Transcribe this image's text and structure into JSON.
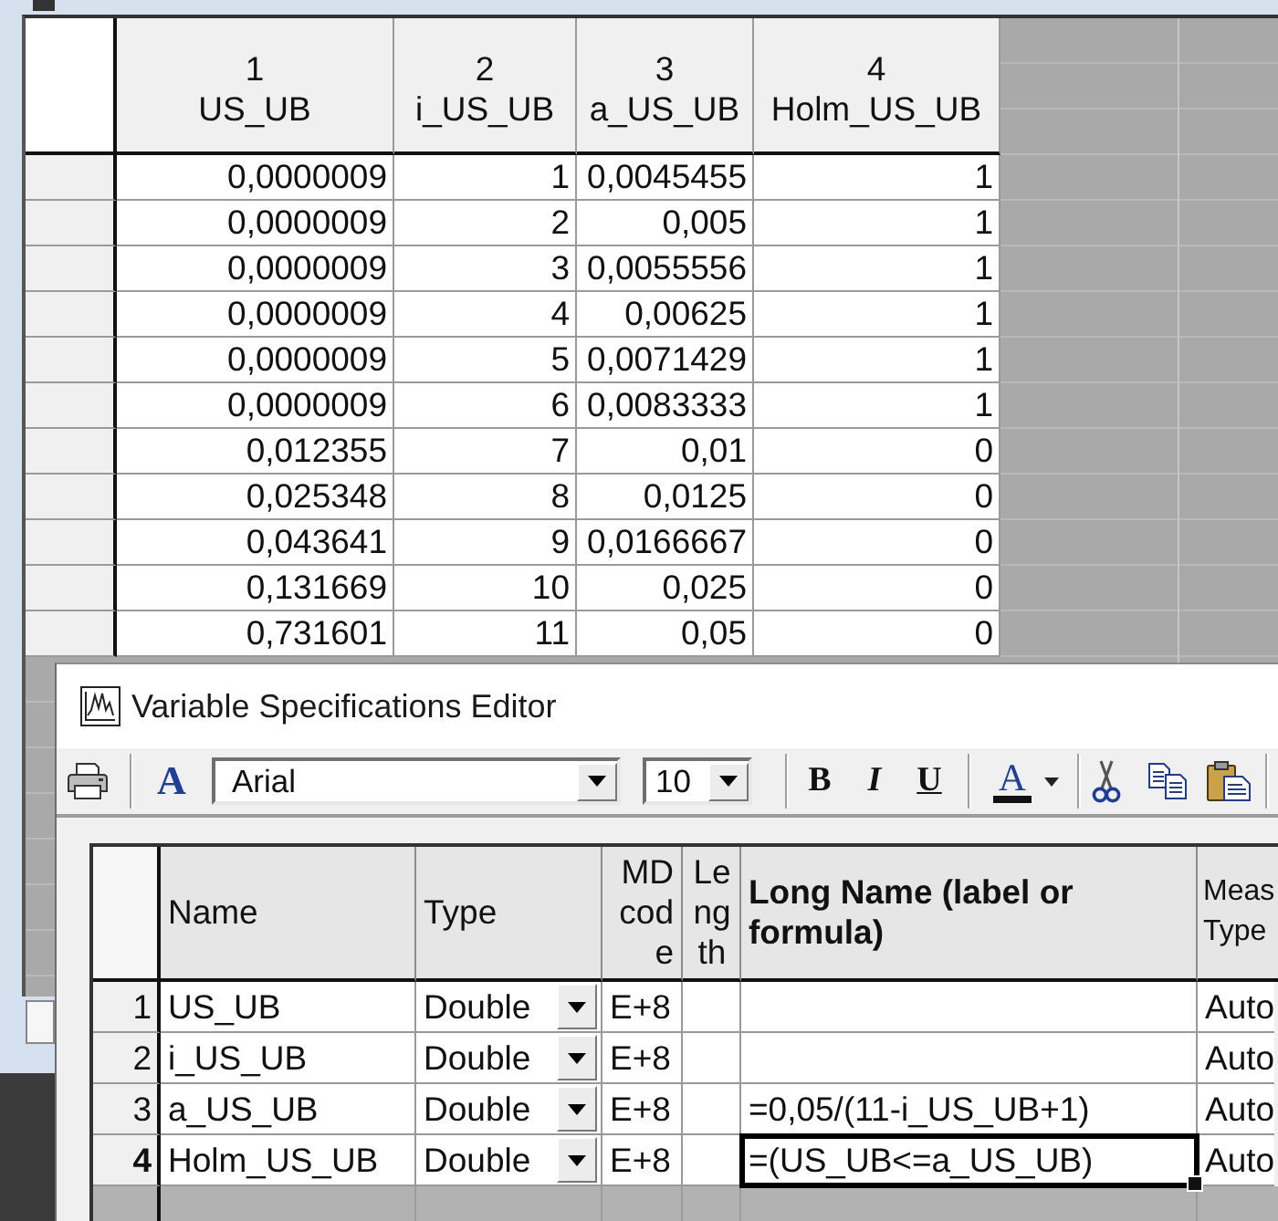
{
  "data_window": {
    "columns": [
      {
        "number": "1",
        "name": "US_UB"
      },
      {
        "number": "2",
        "name": "i_US_UB"
      },
      {
        "number": "3",
        "name": "a_US_UB"
      },
      {
        "number": "4",
        "name": "Holm_US_UB"
      }
    ],
    "rows": [
      [
        "0,0000009",
        "1",
        "0,0045455",
        "1"
      ],
      [
        "0,0000009",
        "2",
        "0,005",
        "1"
      ],
      [
        "0,0000009",
        "3",
        "0,0055556",
        "1"
      ],
      [
        "0,0000009",
        "4",
        "0,00625",
        "1"
      ],
      [
        "0,0000009",
        "5",
        "0,0071429",
        "1"
      ],
      [
        "0,0000009",
        "6",
        "0,0083333",
        "1"
      ],
      [
        "0,012355",
        "7",
        "0,01",
        "0"
      ],
      [
        "0,025348",
        "8",
        "0,0125",
        "0"
      ],
      [
        "0,043641",
        "9",
        "0,0166667",
        "0"
      ],
      [
        "0,131669",
        "10",
        "0,025",
        "0"
      ],
      [
        "0,731601",
        "11",
        "0,05",
        "0"
      ]
    ]
  },
  "dialog": {
    "title": "Variable Specifications Editor",
    "toolbar": {
      "font_button": "A",
      "font": "Arial",
      "size": "10",
      "style_buttons": [
        {
          "label": "B",
          "kind": "bold"
        },
        {
          "label": "I",
          "kind": "italic"
        },
        {
          "label": "U",
          "kind": "underline"
        }
      ],
      "color_button": "A"
    },
    "table": {
      "columns": [
        "Name",
        "Type",
        "MD code",
        "Length",
        "Long Name (label or formula)",
        "Meas Type"
      ],
      "rows": [
        {
          "number": "1",
          "name": "US_UB",
          "type": "Double",
          "md_code": "E+8",
          "meas_type": "Auto",
          "selected": false
        },
        {
          "number": "2",
          "name": "i_US_UB",
          "type": "Double",
          "md_code": "E+8",
          "meas_type": "Auto",
          "selected": false
        },
        {
          "number": "3",
          "name": "a_US_UB",
          "type": "Double",
          "md_code": "E+8",
          "long_name": "=0,05/(11-i_US_UB+1)",
          "meas_type": "Auto",
          "selected": false
        },
        {
          "number": "4",
          "name": "Holm_US_UB",
          "type": "Double",
          "md_code": "E+8",
          "long_name": "=(US_UB<=a_US_UB)",
          "meas_type": "Auto",
          "selected": true
        }
      ]
    }
  }
}
